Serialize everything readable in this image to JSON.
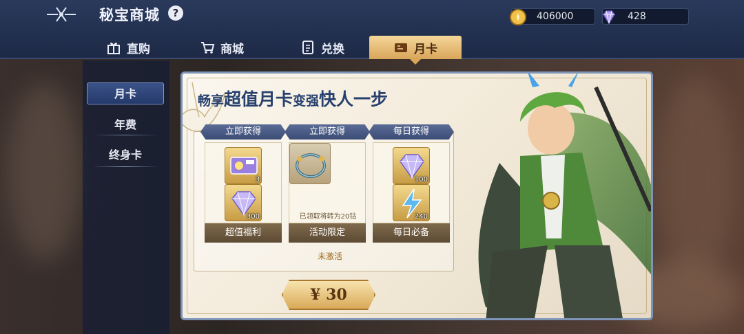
{
  "header": {
    "title": "秘宝商城",
    "help_symbol": "?",
    "logo_icon": "sword-emblem-icon"
  },
  "currencies": {
    "gold": {
      "value": "406000",
      "icon": "gold-coin-icon"
    },
    "gem": {
      "value": "428",
      "icon": "diamond-icon"
    }
  },
  "tabs": [
    {
      "label": "直购",
      "icon": "gift-icon"
    },
    {
      "label": "商城",
      "icon": "cart-icon"
    },
    {
      "label": "兑换",
      "icon": "exchange-icon"
    },
    {
      "label": "月卡",
      "icon": "card-icon",
      "active": true
    }
  ],
  "sidebar": {
    "items": [
      {
        "label": "月卡",
        "active": true
      },
      {
        "label": "年费"
      },
      {
        "label": "终身卡"
      }
    ]
  },
  "card": {
    "headline": [
      "畅享",
      "超值月卡",
      "变强",
      "快人一步"
    ],
    "groups": [
      {
        "header": "立即获得",
        "footer": "超值福利",
        "items": [
          {
            "icon": "ticket-icon",
            "qty": "3"
          },
          {
            "icon": "diamond-icon",
            "qty": "300"
          }
        ]
      },
      {
        "header": "立即获得",
        "footer": "活动限定",
        "items": [
          {
            "icon": "bracelet-icon",
            "note": "已领取将转为20钻"
          }
        ]
      },
      {
        "header": "每日获得",
        "footer": "每日必备",
        "items": [
          {
            "icon": "diamond-icon",
            "qty": "100"
          },
          {
            "icon": "lightning-energy-icon",
            "qty": "240"
          }
        ]
      }
    ],
    "status": "未激活",
    "price": "¥ 30"
  },
  "colors": {
    "header_bg": "#1d2946",
    "active_tab": "#e1b469",
    "card_bg": "#f4ecdc",
    "headline": "#27406e"
  }
}
